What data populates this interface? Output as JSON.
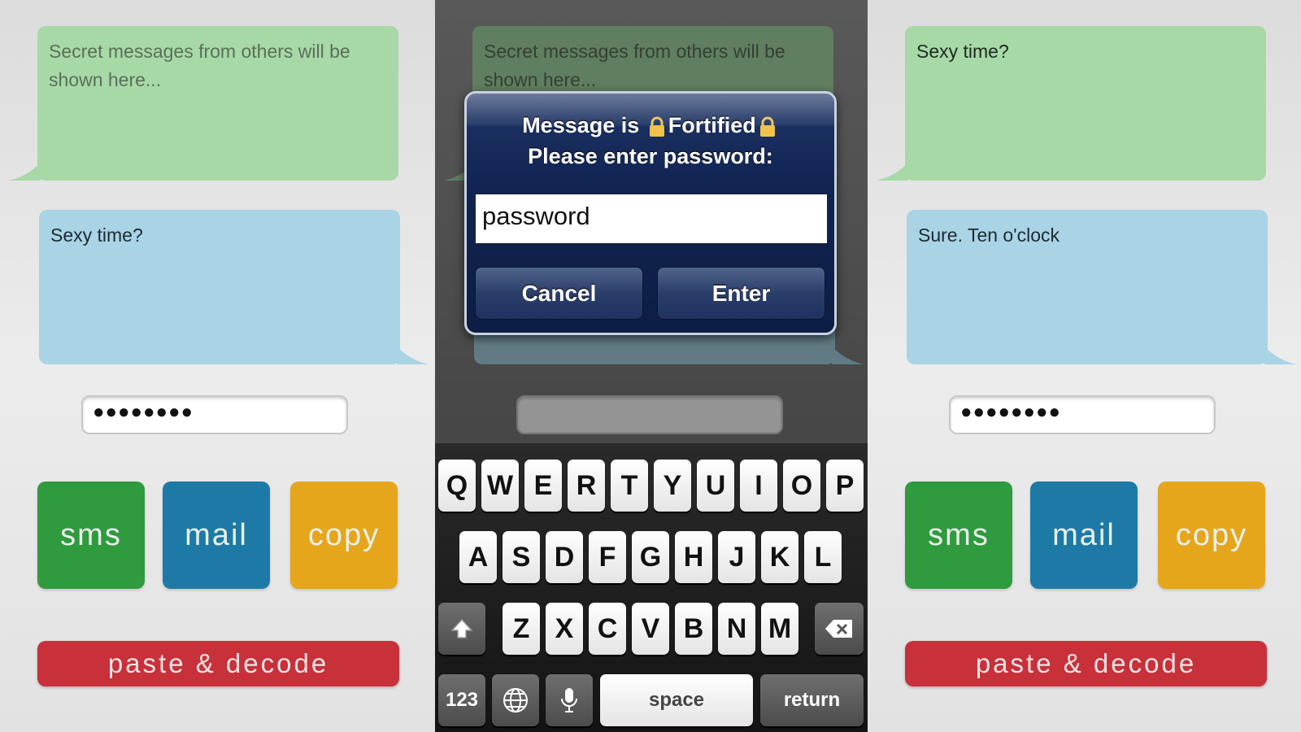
{
  "left_screen": {
    "received_bubble": "Secret messages from others will be shown here...",
    "sent_bubble": "Sexy time?",
    "password_value": "●●●●●●●●",
    "buttons": {
      "sms": "sms",
      "mail": "mail",
      "copy": "copy",
      "decode": "paste & decode"
    }
  },
  "middle_screen": {
    "received_bubble": "Secret messages from others will be shown here...",
    "alert": {
      "title_prefix": "Message is",
      "title_word": "Fortified",
      "title_line2": "Please enter password:",
      "input_value": "password",
      "cancel": "Cancel",
      "enter": "Enter"
    },
    "keyboard": {
      "row1": [
        "Q",
        "W",
        "E",
        "R",
        "T",
        "Y",
        "U",
        "I",
        "O",
        "P"
      ],
      "row2": [
        "A",
        "S",
        "D",
        "F",
        "G",
        "H",
        "J",
        "K",
        "L"
      ],
      "row3": [
        "Z",
        "X",
        "C",
        "V",
        "B",
        "N",
        "M"
      ],
      "numbers": "123",
      "space": "space",
      "return": "return"
    }
  },
  "right_screen": {
    "received_bubble": "Sexy time?",
    "sent_bubble": "Sure. Ten o'clock",
    "password_value": "●●●●●●●●",
    "buttons": {
      "sms": "sms",
      "mail": "mail",
      "copy": "copy",
      "decode": "paste & decode"
    }
  },
  "colors": {
    "green_bubble": "#a6d9a6",
    "blue_bubble": "#a8d4e6",
    "sms": "#2f9a3e",
    "mail": "#1d7aa6",
    "copy": "#e6a61c",
    "decode": "#c8303a",
    "alert_bg": "#112452"
  },
  "icons": [
    "lock-icon",
    "shift-icon",
    "backspace-icon",
    "globe-icon",
    "microphone-icon"
  ]
}
